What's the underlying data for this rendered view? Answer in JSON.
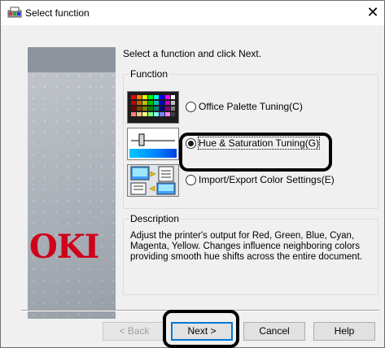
{
  "window": {
    "title": "Select function",
    "close_symbol": "✕"
  },
  "banner": {
    "logo_text": "OKI"
  },
  "instruction": "Select a function and click Next.",
  "function_group": {
    "label": "Function",
    "options": [
      {
        "label": "Office Palette Tuning(C)",
        "icon": "palette-grid-icon",
        "selected": false
      },
      {
        "label": "Hue & Saturation Tuning(G)",
        "icon": "hue-slider-icon",
        "selected": true
      },
      {
        "label": "Import/Export Color Settings(E)",
        "icon": "import-export-icon",
        "selected": false
      }
    ]
  },
  "description": {
    "label": "Description",
    "text": "Adjust the printer's output for Red, Green, Blue, Cyan, Magenta, Yellow.  Changes influence neighboring colors providing smooth hue shifts across the entire document."
  },
  "buttons": {
    "back": "< Back",
    "next": "Next >",
    "cancel": "Cancel",
    "help": "Help"
  },
  "colors": {
    "logo_red": "#d0021b",
    "annotation_black": "#000000",
    "default_button_blue": "#0078d7"
  }
}
